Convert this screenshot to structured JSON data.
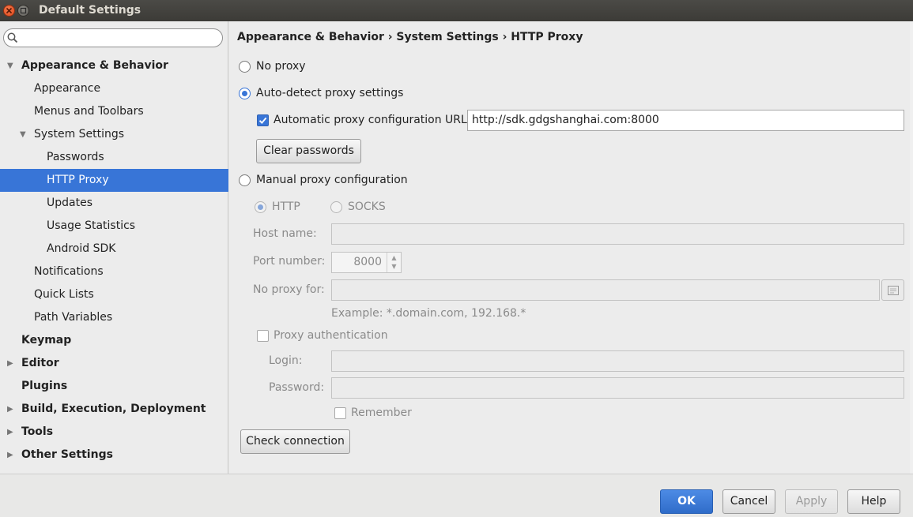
{
  "window": {
    "title": "Default Settings"
  },
  "search": {
    "placeholder": "",
    "value": ""
  },
  "sidebar": {
    "items": [
      {
        "label": "Appearance & Behavior",
        "expanded": true
      },
      {
        "label": "Appearance"
      },
      {
        "label": "Menus and Toolbars"
      },
      {
        "label": "System Settings",
        "expanded": true
      },
      {
        "label": "Passwords"
      },
      {
        "label": "HTTP Proxy",
        "selected": true
      },
      {
        "label": "Updates"
      },
      {
        "label": "Usage Statistics"
      },
      {
        "label": "Android SDK"
      },
      {
        "label": "Notifications"
      },
      {
        "label": "Quick Lists"
      },
      {
        "label": "Path Variables"
      },
      {
        "label": "Keymap"
      },
      {
        "label": "Editor",
        "expanded": false
      },
      {
        "label": "Plugins"
      },
      {
        "label": "Build, Execution, Deployment",
        "expanded": false
      },
      {
        "label": "Tools",
        "expanded": false
      },
      {
        "label": "Other Settings",
        "expanded": false
      }
    ]
  },
  "main": {
    "breadcrumb": "Appearance & Behavior › System Settings › HTTP Proxy",
    "no_proxy_label": "No proxy",
    "auto_detect_label": "Auto-detect proxy settings",
    "auto_url_checkbox_label": "Automatic proxy configuration URL:",
    "auto_url_value": "http://sdk.gdgshanghai.com:8000",
    "clear_passwords_label": "Clear passwords",
    "manual_label": "Manual proxy configuration",
    "http_label": "HTTP",
    "socks_label": "SOCKS",
    "host_name_label": "Host name:",
    "host_name_value": "",
    "port_number_label": "Port number:",
    "port_value": "8000",
    "no_proxy_for_label": "No proxy for:",
    "no_proxy_for_value": "",
    "example_text": "Example: *.domain.com, 192.168.*",
    "proxy_auth_label": "Proxy authentication",
    "login_label": "Login:",
    "login_value": "",
    "password_label": "Password:",
    "password_value": "",
    "remember_label": "Remember",
    "check_connection_label": "Check connection",
    "selected_proxy_mode": "Auto-detect proxy settings",
    "auto_url_checked": true
  },
  "footer": {
    "ok_label": "OK",
    "cancel_label": "Cancel",
    "apply_label": "Apply",
    "help_label": "Help"
  },
  "colors": {
    "accent": "#3875d7",
    "title_bar": "#3c3b37",
    "close_button": "#e0491d"
  }
}
